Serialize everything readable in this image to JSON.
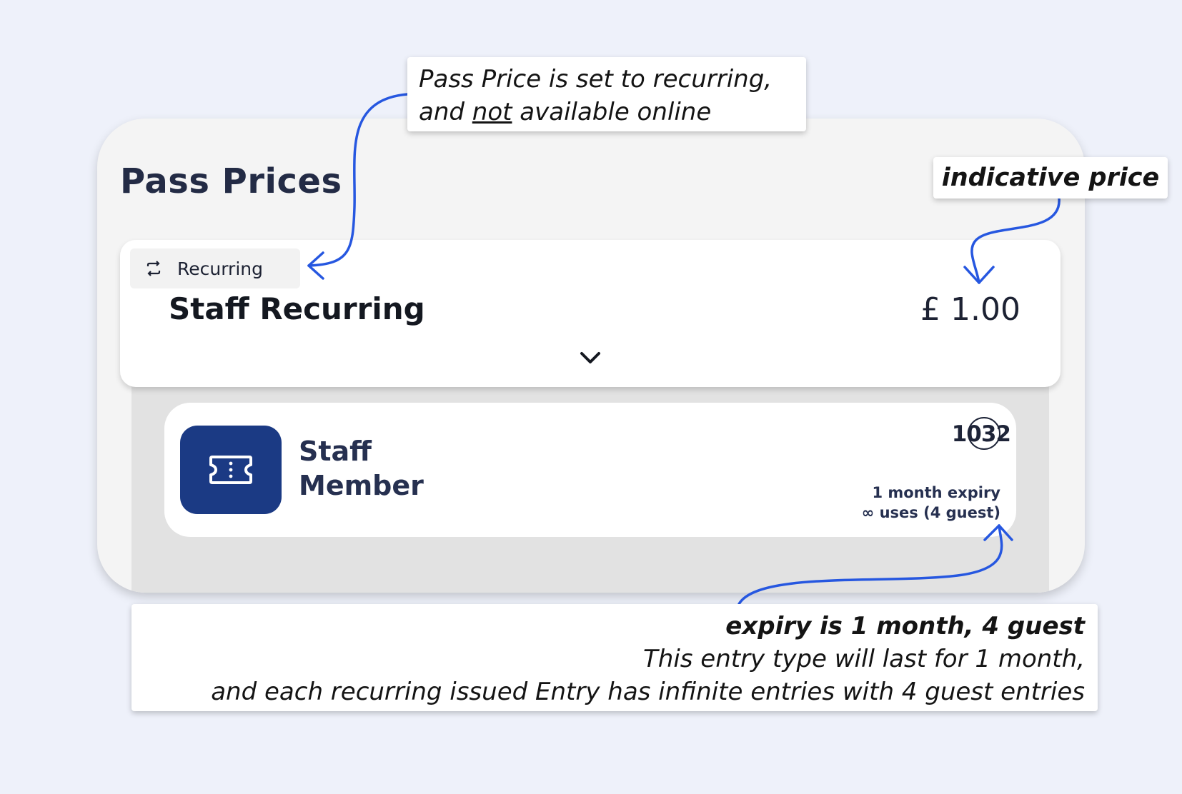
{
  "panel": {
    "title": "Pass Prices"
  },
  "price_card": {
    "tag_icon": "repeat-icon",
    "tag_label": "Recurring",
    "name": "Staff Recurring",
    "amount": "£ 1.00",
    "expand_icon": "chevron-down-icon"
  },
  "entry_card": {
    "icon": "ticket-icon",
    "name_line1": "Staff",
    "name_line2": "Member",
    "id": "1032",
    "expiry": "1 month expiry",
    "uses": "∞ uses (4 guest)"
  },
  "annotations": {
    "recurring_note": {
      "line1": "Pass Price is set to recurring,",
      "line2_prefix": "and ",
      "line2_emphasis": "not",
      "line2_suffix": " available online"
    },
    "price_note": "indicative price",
    "expiry_note": {
      "heading": "expiry is 1 month, 4 guest",
      "line1": "This entry type will last for 1 month,",
      "line2": "and each recurring issued Entry has infinite entries with 4 guest entries"
    },
    "arrow_color": "#2657e0"
  },
  "colors": {
    "background": "#eef1fa",
    "panel": "#f4f4f4",
    "tile": "#1b3a84",
    "title": "#232b45"
  }
}
